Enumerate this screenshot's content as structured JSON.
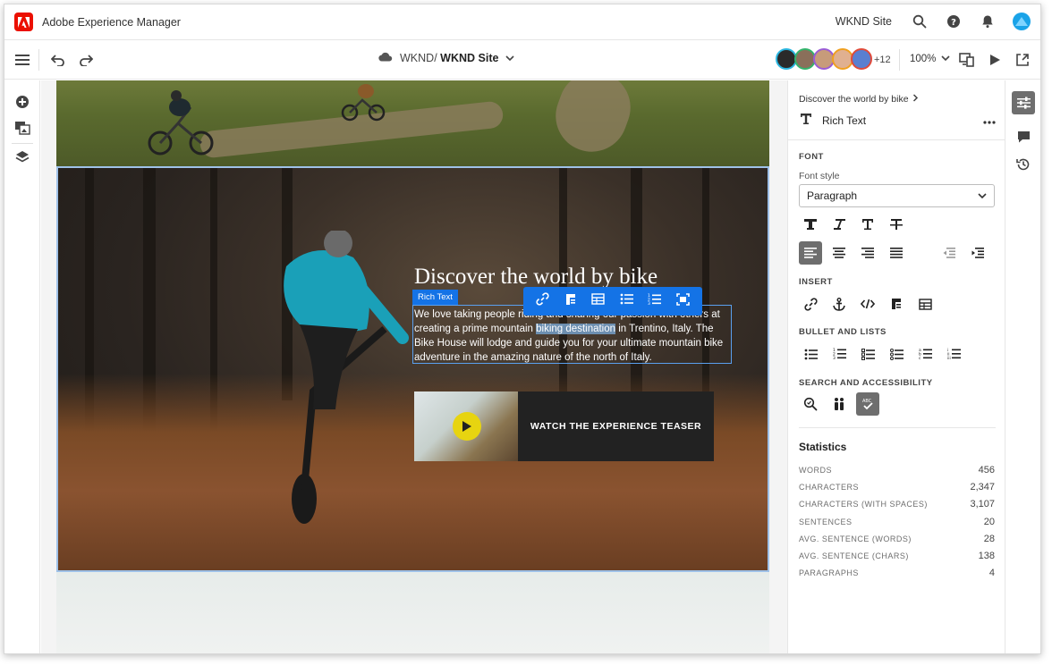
{
  "shell": {
    "app_name": "Adobe Experience Manager",
    "site_name": "WKND Site"
  },
  "toolbar": {
    "crumb_prefix": "WKND/",
    "crumb_current": "WKND Site",
    "avatar_count": "+12",
    "zoom": "100%"
  },
  "hero": {
    "title": "Discover the world by bike",
    "rich_text_tag": "Rich Text",
    "text_before": "We love taking people riding and sharing our passion with others at creating a prime mountain ",
    "text_highlight": "biking destination",
    "text_after": " in Trentino, Italy. The Bike House will lodge and guide you for your ultimate mountain bike adventure in the amazing nature of the north of Italy.",
    "teaser_label": "WATCH THE EXPERIENCE TEASER"
  },
  "panel": {
    "breadcrumb": "Discover the world by bike",
    "component": "Rich Text",
    "font_section": "FONT",
    "font_style_label": "Font style",
    "font_style_value": "Paragraph",
    "insert_section": "INSERT",
    "lists_section": "BULLET AND LISTS",
    "search_section": "SEARCH AND ACCESSIBILITY",
    "stats_title": "Statistics",
    "stats": [
      {
        "label": "WORDS",
        "value": "456"
      },
      {
        "label": "CHARACTERS",
        "value": "2,347"
      },
      {
        "label": "CHARACTERS (WITH SPACES)",
        "value": "3,107"
      },
      {
        "label": "SENTENCES",
        "value": "20"
      },
      {
        "label": "AVG. SENTENCE (WORDS)",
        "value": "28"
      },
      {
        "label": "AVG. SENTENCE (CHARS)",
        "value": "138"
      },
      {
        "label": "PARAGRAPHS",
        "value": "4"
      }
    ]
  },
  "colors": {
    "accent": "#1473e6",
    "brand": "#eb1000",
    "selection": "#9fc1e8"
  },
  "icons": [
    "menu-icon",
    "undo-icon",
    "redo-icon",
    "cloud-icon",
    "search-icon",
    "help-icon",
    "bell-icon",
    "add-icon",
    "layers-icon",
    "assets-icon",
    "play-icon",
    "device-icon",
    "exit-icon",
    "properties-icon",
    "comments-icon",
    "history-icon"
  ]
}
